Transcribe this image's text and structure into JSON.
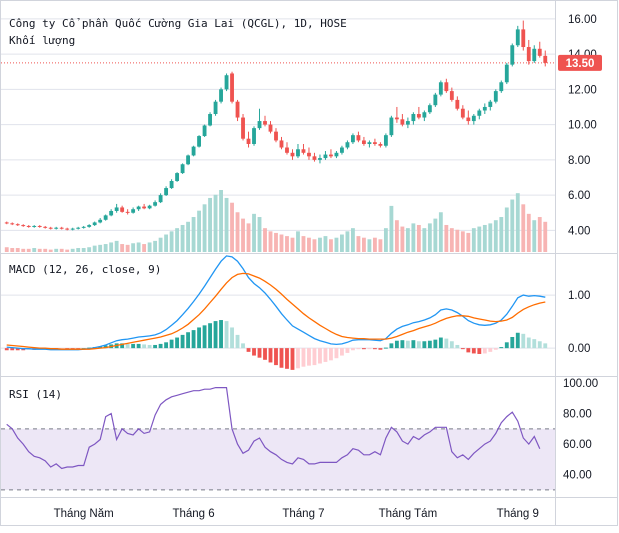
{
  "header": {
    "title": "Công ty Cổ phần Quốc Cường Gia Lai (QCGL), 1D, HOSE",
    "volume_label": "Khối lượng"
  },
  "price_badge": "13.50",
  "macd": {
    "label": "MACD (12, 26, close, 9)"
  },
  "rsi": {
    "label": "RSI (14)"
  },
  "colors": {
    "up": "#26a69a",
    "down": "#ef5350",
    "vol_up": "#a7d8d3",
    "vol_down": "#f7b4b3",
    "macd_line": "#2196f3",
    "signal_line": "#ff6d00",
    "hist_pos_strong": "#26a69a",
    "hist_pos_weak": "#b2dfdb",
    "hist_neg_strong": "#ef5350",
    "hist_neg_weak": "#ffcdd2",
    "rsi_line": "#7e57c2",
    "rsi_band": "#ede7f6",
    "grid": "#e0e3eb",
    "price_line": "#ef5350"
  },
  "chart_data": [
    {
      "type": "candlestick",
      "title": "Công ty Cổ phần Quốc Cường Gia Lai (QCGL), 1D, HOSE",
      "y_ticks": [
        "16.00",
        "14.00",
        "12.00",
        "10.00",
        "8.00",
        "6.00",
        "4.00"
      ],
      "ylim": [
        3.0,
        16.5
      ],
      "x_ticks": [
        "Tháng Năm",
        "Tháng 6",
        "Tháng 7",
        "Tháng Tám",
        "Tháng 9"
      ],
      "x_tick_index": [
        14,
        34,
        54,
        73,
        93
      ],
      "last_price": 13.5,
      "ohlc": [
        [
          4.45,
          4.5,
          4.35,
          4.4
        ],
        [
          4.4,
          4.45,
          4.3,
          4.35
        ],
        [
          4.35,
          4.4,
          4.25,
          4.3
        ],
        [
          4.3,
          4.35,
          4.2,
          4.25
        ],
        [
          4.25,
          4.3,
          4.15,
          4.2
        ],
        [
          4.2,
          4.3,
          4.15,
          4.25
        ],
        [
          4.25,
          4.3,
          4.15,
          4.2
        ],
        [
          4.2,
          4.25,
          4.1,
          4.15
        ],
        [
          4.15,
          4.2,
          4.05,
          4.1
        ],
        [
          4.1,
          4.2,
          4.05,
          4.15
        ],
        [
          4.15,
          4.2,
          4.05,
          4.1
        ],
        [
          4.1,
          4.15,
          4.0,
          4.05
        ],
        [
          4.05,
          4.15,
          4.0,
          4.1
        ],
        [
          4.1,
          4.2,
          4.05,
          4.15
        ],
        [
          4.15,
          4.25,
          4.1,
          4.2
        ],
        [
          4.2,
          4.35,
          4.15,
          4.3
        ],
        [
          4.3,
          4.5,
          4.25,
          4.45
        ],
        [
          4.45,
          4.7,
          4.4,
          4.6
        ],
        [
          4.6,
          4.9,
          4.55,
          4.85
        ],
        [
          4.85,
          5.2,
          4.8,
          5.1
        ],
        [
          5.1,
          5.5,
          5.0,
          5.3
        ],
        [
          5.3,
          5.4,
          5.0,
          5.05
        ],
        [
          5.05,
          5.2,
          4.9,
          5.0
        ],
        [
          5.0,
          5.3,
          4.95,
          5.2
        ],
        [
          5.2,
          5.4,
          5.1,
          5.35
        ],
        [
          5.35,
          5.5,
          5.2,
          5.25
        ],
        [
          5.25,
          5.45,
          5.2,
          5.4
        ],
        [
          5.4,
          5.7,
          5.35,
          5.6
        ],
        [
          5.6,
          6.1,
          5.55,
          6.0
        ],
        [
          6.0,
          6.5,
          5.95,
          6.4
        ],
        [
          6.4,
          6.9,
          6.35,
          6.8
        ],
        [
          6.8,
          7.3,
          6.75,
          7.25
        ],
        [
          7.25,
          7.8,
          7.2,
          7.75
        ],
        [
          7.75,
          8.3,
          7.7,
          8.25
        ],
        [
          8.25,
          8.8,
          8.2,
          8.75
        ],
        [
          8.75,
          9.4,
          8.7,
          9.35
        ],
        [
          9.35,
          10.0,
          9.3,
          9.95
        ],
        [
          9.95,
          10.7,
          9.9,
          10.6
        ],
        [
          10.6,
          11.4,
          10.5,
          11.3
        ],
        [
          11.3,
          12.1,
          11.2,
          12.0
        ],
        [
          12.0,
          12.9,
          11.9,
          12.8
        ],
        [
          12.9,
          13.0,
          11.2,
          11.3
        ],
        [
          11.3,
          11.4,
          10.2,
          10.4
        ],
        [
          10.4,
          10.6,
          9.1,
          9.2
        ],
        [
          9.2,
          9.6,
          8.7,
          8.9
        ],
        [
          8.9,
          9.9,
          8.8,
          9.8
        ],
        [
          9.8,
          10.9,
          9.7,
          10.2
        ],
        [
          10.2,
          10.5,
          9.9,
          10.0
        ],
        [
          10.0,
          10.2,
          9.5,
          9.6
        ],
        [
          9.6,
          9.8,
          9.0,
          9.1
        ],
        [
          9.1,
          9.3,
          8.6,
          8.7
        ],
        [
          8.7,
          9.0,
          8.3,
          8.4
        ],
        [
          8.4,
          8.6,
          8.0,
          8.2
        ],
        [
          8.2,
          8.9,
          8.1,
          8.6
        ],
        [
          8.6,
          8.9,
          8.3,
          8.4
        ],
        [
          8.4,
          8.7,
          8.0,
          8.2
        ],
        [
          8.2,
          8.4,
          7.9,
          8.0
        ],
        [
          8.0,
          8.3,
          7.8,
          8.1
        ],
        [
          8.1,
          8.5,
          8.0,
          8.3
        ],
        [
          8.3,
          8.6,
          8.1,
          8.2
        ],
        [
          8.2,
          8.5,
          8.1,
          8.4
        ],
        [
          8.4,
          8.8,
          8.3,
          8.7
        ],
        [
          8.7,
          9.1,
          8.6,
          9.0
        ],
        [
          9.0,
          9.5,
          8.9,
          9.4
        ],
        [
          9.4,
          9.6,
          9.0,
          9.1
        ],
        [
          9.1,
          9.3,
          8.8,
          8.9
        ],
        [
          8.9,
          9.1,
          8.7,
          9.0
        ],
        [
          9.0,
          9.2,
          8.8,
          8.9
        ],
        [
          8.9,
          9.0,
          8.7,
          8.8
        ],
        [
          8.8,
          9.5,
          8.7,
          9.4
        ],
        [
          9.4,
          10.5,
          9.3,
          10.4
        ],
        [
          10.4,
          11.0,
          10.1,
          10.3
        ],
        [
          10.3,
          10.6,
          9.9,
          10.0
        ],
        [
          10.0,
          10.4,
          9.8,
          10.2
        ],
        [
          10.2,
          10.7,
          10.0,
          10.6
        ],
        [
          10.6,
          11.0,
          10.3,
          10.4
        ],
        [
          10.4,
          10.8,
          10.2,
          10.7
        ],
        [
          10.7,
          11.2,
          10.6,
          11.1
        ],
        [
          11.1,
          11.8,
          11.0,
          11.7
        ],
        [
          11.7,
          12.5,
          11.6,
          12.4
        ],
        [
          12.4,
          12.6,
          11.8,
          11.9
        ],
        [
          11.9,
          12.1,
          11.3,
          11.4
        ],
        [
          11.4,
          11.6,
          10.8,
          10.9
        ],
        [
          10.9,
          11.1,
          10.3,
          10.4
        ],
        [
          10.4,
          10.8,
          10.0,
          10.2
        ],
        [
          10.2,
          10.6,
          10.0,
          10.5
        ],
        [
          10.5,
          10.9,
          10.3,
          10.8
        ],
        [
          10.8,
          11.2,
          10.6,
          11.0
        ],
        [
          11.0,
          11.4,
          10.8,
          11.3
        ],
        [
          11.3,
          12.0,
          11.2,
          11.9
        ],
        [
          11.9,
          12.5,
          11.8,
          12.4
        ],
        [
          12.4,
          13.5,
          12.3,
          13.4
        ],
        [
          13.4,
          14.6,
          13.3,
          14.5
        ],
        [
          14.5,
          15.6,
          14.4,
          15.4
        ],
        [
          15.4,
          15.9,
          14.2,
          14.4
        ],
        [
          14.4,
          14.8,
          13.4,
          13.6
        ],
        [
          13.6,
          14.5,
          13.5,
          14.3
        ],
        [
          14.3,
          14.7,
          13.8,
          13.9
        ],
        [
          13.9,
          14.2,
          13.3,
          13.5
        ]
      ]
    },
    {
      "type": "bar",
      "title": "Khối lượng",
      "values": [
        6,
        5,
        5,
        4,
        4,
        5,
        4,
        4,
        3,
        4,
        4,
        3,
        4,
        5,
        5,
        6,
        8,
        9,
        10,
        12,
        14,
        10,
        9,
        11,
        12,
        10,
        12,
        14,
        18,
        22,
        26,
        30,
        34,
        38,
        44,
        52,
        60,
        68,
        72,
        78,
        68,
        62,
        50,
        42,
        36,
        48,
        44,
        30,
        26,
        24,
        22,
        20,
        18,
        26,
        20,
        18,
        16,
        18,
        20,
        16,
        18,
        22,
        26,
        30,
        20,
        18,
        16,
        18,
        16,
        30,
        58,
        40,
        32,
        30,
        36,
        34,
        30,
        36,
        42,
        50,
        34,
        30,
        28,
        26,
        24,
        30,
        32,
        34,
        36,
        40,
        44,
        56,
        66,
        74,
        60,
        48,
        40,
        44,
        38
      ]
    },
    {
      "type": "line",
      "title": "MACD (12, 26, close, 9)",
      "y_ticks": [
        "1.00",
        "0.00"
      ],
      "ylim": [
        -0.45,
        1.7
      ],
      "series": [
        {
          "values": [
            0.02,
            0.01,
            0.0,
            -0.01,
            -0.01,
            -0.02,
            -0.02,
            -0.02,
            -0.03,
            -0.03,
            -0.03,
            -0.03,
            -0.03,
            -0.03,
            -0.02,
            -0.01,
            0.01,
            0.03,
            0.06,
            0.1,
            0.14,
            0.16,
            0.17,
            0.19,
            0.21,
            0.22,
            0.23,
            0.25,
            0.29,
            0.35,
            0.43,
            0.52,
            0.63,
            0.75,
            0.88,
            1.02,
            1.17,
            1.33,
            1.49,
            1.64,
            1.74,
            1.72,
            1.64,
            1.5,
            1.33,
            1.22,
            1.14,
            1.04,
            0.92,
            0.79,
            0.65,
            0.53,
            0.42,
            0.36,
            0.3,
            0.24,
            0.18,
            0.14,
            0.11,
            0.08,
            0.07,
            0.08,
            0.11,
            0.15,
            0.16,
            0.16,
            0.16,
            0.15,
            0.14,
            0.18,
            0.28,
            0.36,
            0.41,
            0.44,
            0.48,
            0.5,
            0.53,
            0.57,
            0.63,
            0.72,
            0.74,
            0.72,
            0.67,
            0.6,
            0.52,
            0.47,
            0.44,
            0.43,
            0.44,
            0.47,
            0.53,
            0.64,
            0.79,
            0.95,
            1.0,
            0.98,
            0.99,
            0.98,
            0.96
          ]
        },
        {
          "values": [
            0.06,
            0.05,
            0.04,
            0.03,
            0.02,
            0.01,
            0.0,
            0.0,
            -0.01,
            -0.01,
            -0.02,
            -0.02,
            -0.02,
            -0.02,
            -0.02,
            -0.02,
            -0.01,
            0.0,
            0.01,
            0.03,
            0.05,
            0.07,
            0.09,
            0.11,
            0.13,
            0.15,
            0.17,
            0.19,
            0.21,
            0.24,
            0.27,
            0.32,
            0.38,
            0.45,
            0.54,
            0.63,
            0.74,
            0.86,
            0.98,
            1.11,
            1.23,
            1.33,
            1.39,
            1.41,
            1.4,
            1.36,
            1.32,
            1.26,
            1.19,
            1.11,
            1.02,
            0.92,
            0.83,
            0.74,
            0.65,
            0.57,
            0.5,
            0.43,
            0.37,
            0.31,
            0.26,
            0.22,
            0.2,
            0.19,
            0.18,
            0.18,
            0.17,
            0.17,
            0.17,
            0.17,
            0.19,
            0.22,
            0.26,
            0.3,
            0.33,
            0.37,
            0.4,
            0.43,
            0.47,
            0.52,
            0.56,
            0.59,
            0.61,
            0.61,
            0.6,
            0.57,
            0.55,
            0.53,
            0.51,
            0.5,
            0.51,
            0.53,
            0.58,
            0.66,
            0.73,
            0.78,
            0.82,
            0.85,
            0.87
          ]
        }
      ],
      "histogram": [
        -0.04,
        -0.04,
        -0.04,
        -0.04,
        -0.03,
        -0.03,
        -0.02,
        -0.02,
        -0.02,
        -0.02,
        -0.01,
        -0.01,
        -0.01,
        -0.01,
        0.0,
        0.01,
        0.02,
        0.03,
        0.05,
        0.07,
        0.09,
        0.09,
        0.08,
        0.08,
        0.08,
        0.07,
        0.06,
        0.06,
        0.08,
        0.11,
        0.16,
        0.2,
        0.25,
        0.3,
        0.34,
        0.39,
        0.43,
        0.47,
        0.51,
        0.53,
        0.51,
        0.39,
        0.25,
        0.09,
        -0.07,
        -0.14,
        -0.18,
        -0.22,
        -0.27,
        -0.32,
        -0.37,
        -0.39,
        -0.41,
        -0.38,
        -0.35,
        -0.33,
        -0.32,
        -0.29,
        -0.26,
        -0.23,
        -0.19,
        -0.14,
        -0.09,
        -0.04,
        -0.02,
        -0.02,
        -0.01,
        -0.02,
        -0.03,
        0.01,
        0.09,
        0.14,
        0.15,
        0.14,
        0.15,
        0.13,
        0.13,
        0.14,
        0.16,
        0.2,
        0.18,
        0.13,
        0.06,
        -0.01,
        -0.08,
        -0.1,
        -0.11,
        -0.1,
        -0.07,
        -0.03,
        0.02,
        0.11,
        0.21,
        0.29,
        0.27,
        0.2,
        0.17,
        0.13,
        0.09
      ]
    },
    {
      "type": "line",
      "title": "RSI (14)",
      "y_ticks": [
        "100.00",
        "80.00",
        "60.00",
        "40.00"
      ],
      "ylim": [
        26,
        102
      ],
      "band": [
        30,
        70
      ],
      "series": [
        {
          "values": [
            73,
            70,
            64,
            60,
            55,
            52,
            51,
            49,
            45,
            47,
            44,
            45,
            45,
            46,
            46,
            58,
            60,
            63,
            78,
            80,
            63,
            70,
            67,
            66,
            70,
            67,
            68,
            79,
            86,
            89,
            91,
            92,
            93,
            94,
            95,
            95,
            96,
            96,
            97,
            97,
            97,
            70,
            60,
            54,
            56,
            62,
            64,
            58,
            55,
            53,
            50,
            48,
            47,
            51,
            50,
            47,
            47,
            48,
            48,
            48,
            48,
            51,
            53,
            57,
            56,
            53,
            53,
            55,
            53,
            64,
            71,
            68,
            62,
            60,
            65,
            63,
            66,
            68,
            71,
            71,
            71,
            55,
            51,
            53,
            50,
            54,
            57,
            60,
            62,
            67,
            74,
            78,
            81,
            75,
            64,
            60,
            65,
            57
          ]
        }
      ]
    }
  ]
}
